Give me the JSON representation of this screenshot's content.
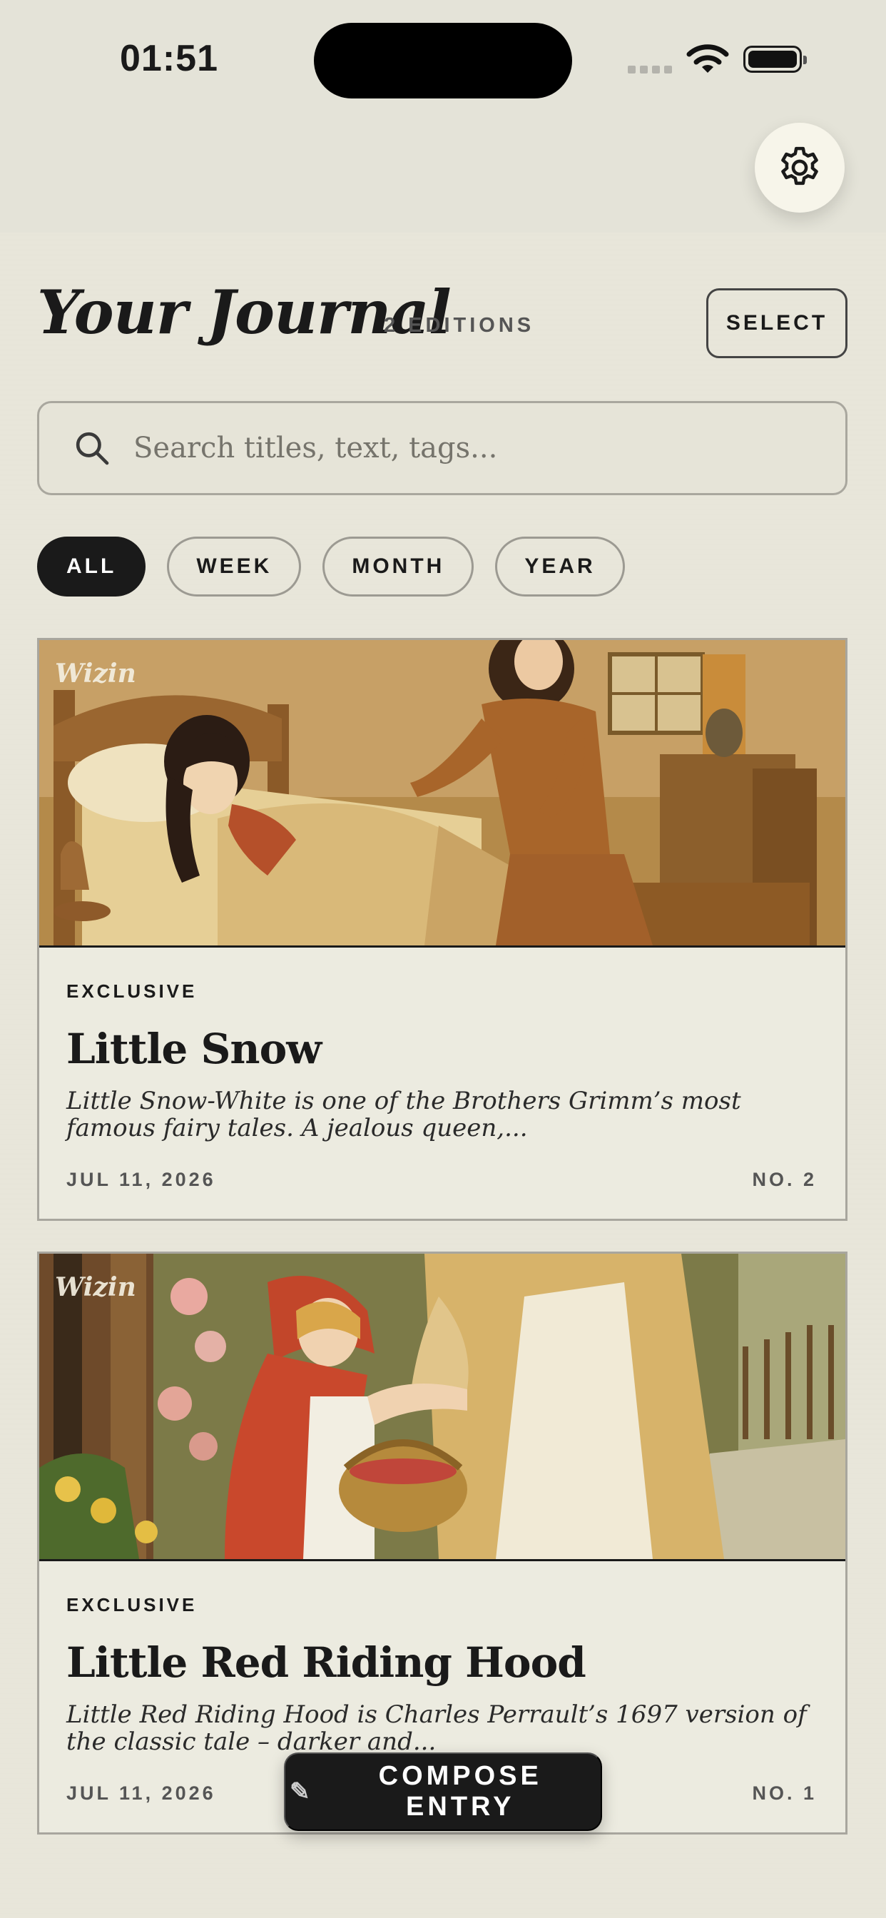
{
  "status_bar": {
    "time": "01:51"
  },
  "header": {
    "title": "Your Journal",
    "count": "2 EDITIONS",
    "select_label": "SELECT"
  },
  "search": {
    "placeholder": "Search titles, text, tags..."
  },
  "filters": [
    {
      "label": "ALL",
      "active": true
    },
    {
      "label": "WEEK",
      "active": false
    },
    {
      "label": "MONTH",
      "active": false
    },
    {
      "label": "YEAR",
      "active": false
    }
  ],
  "entries": [
    {
      "watermark": "Wizin",
      "tag": "EXCLUSIVE",
      "title": "Little Snow",
      "excerpt": "Little Snow-White is one of the Brothers Grimm’s most famous fairy tales. A jealous queen,...",
      "date": "JUL 11, 2026",
      "number": "NO. 2"
    },
    {
      "watermark": "Wizin",
      "tag": "EXCLUSIVE",
      "title": "Little Red Riding Hood",
      "excerpt": "Little Red Riding Hood is Charles Perrault’s 1697 version of the classic tale – darker and...",
      "date": "JUL 11, 2026",
      "number": "NO. 1"
    }
  ],
  "compose": {
    "label": "COMPOSE ENTRY",
    "icon": "pencil-icon"
  },
  "icons": [
    "gear-icon",
    "search-icon",
    "wifi-icon",
    "battery-icon",
    "pencil-icon"
  ],
  "colors": {
    "background": "#e4e3d8",
    "ink": "#1a1a1a",
    "card": "#ecebe0"
  }
}
